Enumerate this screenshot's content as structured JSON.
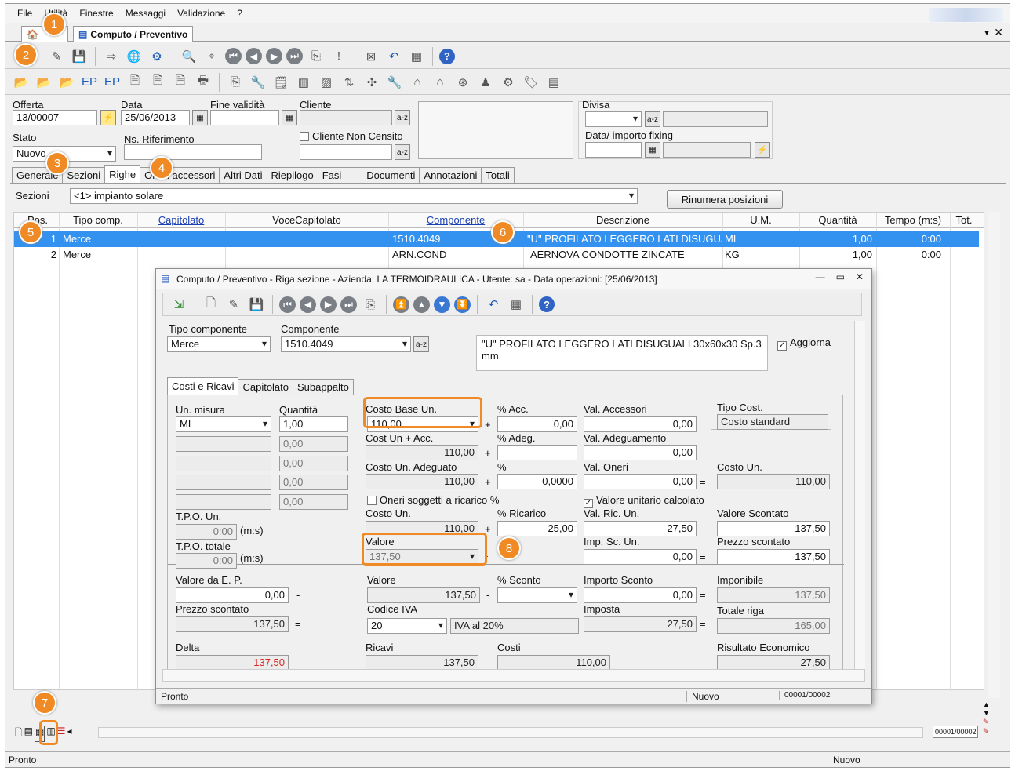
{
  "menu": [
    "File",
    "Utilità",
    "Finestre",
    "Messaggi",
    "Validazione",
    "?"
  ],
  "doc_tab": "Computo / Preventivo",
  "header": {
    "offerta_label": "Offerta",
    "offerta": "13/00007",
    "data_label": "Data",
    "data": "25/06/2013",
    "fine_label": "Fine validità",
    "cliente_label": "Cliente",
    "cliente_nc": "Cliente Non Censito",
    "stato_label": "Stato",
    "stato": "Nuovo",
    "nsrif_label": "Ns. Riferimento",
    "divisa_label": "Divisa",
    "fixing_label": "Data/ importo fixing"
  },
  "tabs": [
    "Generale",
    "Sezioni",
    "Righe",
    "Oneri accessori",
    "Altri Dati",
    "Riepilogo",
    "Fasi",
    "Documenti",
    "Annotazioni",
    "Totali"
  ],
  "sezioni_label": "Sezioni",
  "sezioni_value": "<1> impianto solare",
  "rinumera": "Rinumera posizioni",
  "columns": [
    "Pos.",
    "Tipo comp.",
    "Capitolato",
    "VoceCapitolato",
    "Componente",
    "Descrizione",
    "U.M.",
    "Quantità",
    "Tempo (m:s)",
    "Tot."
  ],
  "rows": [
    {
      "pos": "1",
      "tipo": "Merce",
      "comp": "1510.4049",
      "desc": "\"U\" PROFILATO LEGGERO LATI DISUGUALI",
      "um": "ML",
      "qty": "1,00",
      "tempo": "0:00"
    },
    {
      "pos": "2",
      "tipo": "Merce",
      "comp": "ARN.COND",
      "desc": "AERNOVA CONDOTTE ZINCATE",
      "um": "KG",
      "qty": "1,00",
      "tempo": "0:00"
    }
  ],
  "status": {
    "left": "Pronto",
    "mid": "Nuovo",
    "pager": "00001/00002"
  },
  "badges": [
    "1",
    "2",
    "3",
    "4",
    "5",
    "6",
    "7",
    "8"
  ],
  "dialog": {
    "title": "Computo / Preventivo - Riga sezione - Azienda: LA TERMOIDRAULICA - Utente: sa - Data operazioni: [25/06/2013]",
    "tipo_label": "Tipo componente",
    "tipo": "Merce",
    "comp_label": "Componente",
    "comp": "1510.4049",
    "desc": "\"U\" PROFILATO LEGGERO LATI DISUGUALI 30x60x30 Sp.3 mm",
    "aggiorna": "Aggiorna",
    "tabs": [
      "Costi e Ricavi",
      "Capitolato",
      "Subappalto"
    ],
    "um_label": "Un. misura",
    "um": "ML",
    "qty_label": "Quantità",
    "qty": "1,00",
    "qty_zero": "0,00",
    "tpo_un_label": "T.P.O. Un.",
    "tpo_tot_label": "T.P.O. totale",
    "tpo": "0:00",
    "ms": "(m:s)",
    "costo_base_label": "Costo Base Un.",
    "costo_base": "110,00",
    "acc_label": "% Acc.",
    "acc": "0,00",
    "val_acc_label": "Val. Accessori",
    "val_acc": "0,00",
    "tipo_cost_label": "Tipo Cost.",
    "tipo_cost": "Costo standard",
    "cost_acc_label": "Cost Un + Acc.",
    "cost_acc": "110,00",
    "adeg_label": "% Adeg.",
    "val_adeg_label": "Val. Adeguamento",
    "val_adeg": "0,00",
    "costo_adeg_label": "Costo Un. Adeguato",
    "costo_adeg": "110,00",
    "perc_label": "%",
    "perc": "0,0000",
    "val_oneri_label": "Val. Oneri",
    "val_oneri": "0,00",
    "costo_un_label": "Costo Un.",
    "costo_un": "110,00",
    "oneri_chk": "Oneri soggetti a ricarico %",
    "valore_calc_chk": "Valore unitario calcolato",
    "costo_un2": "110,00",
    "ricarico_label": "% Ricarico",
    "ricarico": "25,00",
    "val_ric_label": "Val. Ric. Un.",
    "val_ric": "27,50",
    "val_sc_label": "Valore Scontato",
    "val_sc": "137,50",
    "valore_label": "Valore",
    "valore": "137,50",
    "imp_sc_label": "Imp. Sc. Un.",
    "imp_sc": "0,00",
    "prezzo_sc_label": "Prezzo scontato",
    "prezzo_sc": "137,50",
    "val_ep_label": "Valore da E. P.",
    "val_ep": "0,00",
    "prezzo_sc2": "137,50",
    "valore2": "137,50",
    "sconto_label": "% Sconto",
    "imp_sconto_label": "Importo Sconto",
    "imp_sconto": "0,00",
    "imponibile_label": "Imponibile",
    "imponibile": "137,50",
    "iva_label": "Codice IVA",
    "iva": "20",
    "iva_desc": "IVA al 20%",
    "imposta_label": "Imposta",
    "imposta": "27,50",
    "tot_riga_label": "Totale riga",
    "tot_riga": "165,00",
    "delta_label": "Delta",
    "delta": "137,50",
    "ricavi_label": "Ricavi",
    "ricavi": "137,50",
    "costi_label": "Costi",
    "costi": "110,00",
    "ris_label": "Risultato Economico",
    "ris": "27,50",
    "status_left": "Pronto",
    "status_mid": "Nuovo",
    "status_pager": "00001/00002"
  },
  "colors": {
    "accent": "#f08a24",
    "selection": "#3392f0",
    "link": "#1a3fb3"
  }
}
